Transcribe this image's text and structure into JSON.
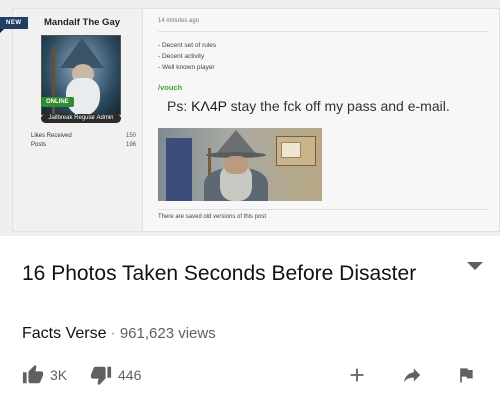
{
  "forum_post": {
    "new_badge": "NEW",
    "username": "Mandalf The Gay",
    "online_badge": "ONLINE",
    "role": "Jailbreak Regular Admin",
    "stats": [
      {
        "label": "Likes Received",
        "value": "150"
      },
      {
        "label": "Posts",
        "value": "196"
      }
    ],
    "timestamp": "14 minutes ago",
    "rules": [
      "- Decent set of rules",
      "- Decent activity",
      "- Well known player"
    ],
    "vouch": "/vouch",
    "ps_prefix": "Ps: ",
    "ps_nick": "KΛ4P",
    "ps_suffix": " stay the fck off my pass and e-mail.",
    "saved_versions_note": "There are saved old versions of this post"
  },
  "video": {
    "title": "16 Photos Taken Seconds Before Disaster",
    "channel": "Facts Verse",
    "separator": "·",
    "views": "961,623 views",
    "likes": "3K",
    "dislikes": "446"
  },
  "colors": {
    "vouch_green": "#3aa82e",
    "new_badge": "#1f3f63",
    "online_badge": "#2f8c2f",
    "icon_gray": "#606060"
  }
}
